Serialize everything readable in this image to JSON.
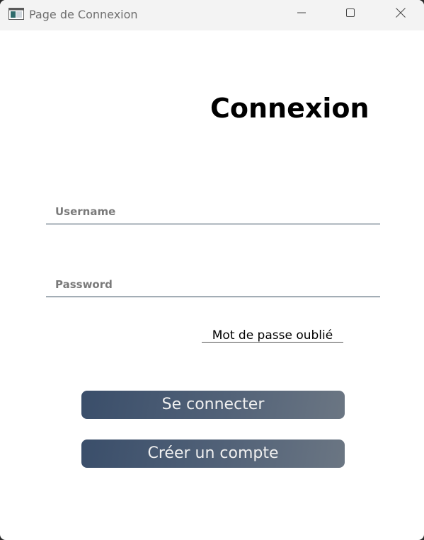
{
  "window": {
    "title": "Page de Connexion",
    "icon": "app-window-icon",
    "controls": {
      "minimize_icon": "minimize-icon",
      "maximize_icon": "maximize-icon",
      "close_icon": "close-icon"
    }
  },
  "form": {
    "heading": "Connexion",
    "username": {
      "placeholder": "Username",
      "value": ""
    },
    "password": {
      "placeholder": "Password",
      "value": ""
    },
    "forgot_password_label": "Mot de passe oublié",
    "login_button_label": "Se connecter",
    "create_account_button_label": "Créer un compte"
  },
  "colors": {
    "button_gradient_start": "#3a4e6a",
    "button_gradient_end": "#6b7683",
    "field_underline": "#2f4558",
    "button_text": "#f0f0f0"
  }
}
